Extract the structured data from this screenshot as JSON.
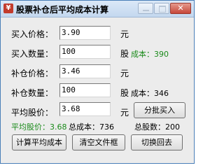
{
  "window": {
    "title": "股票补仓后平均成本计算"
  },
  "form": {
    "buy_price_label": "买入价格：",
    "buy_price_value": "3.90",
    "buy_price_unit": "元",
    "buy_qty_label": "买入数量：",
    "buy_qty_value": "100",
    "buy_qty_unit": "股",
    "buy_cost_text": "成本：390",
    "add_price_label": "补仓价格：",
    "add_price_value": "3.46",
    "add_price_unit": "元",
    "add_qty_label": "补仓数量：",
    "add_qty_value": "100",
    "add_qty_unit": "股",
    "add_cost_text": "成本：346",
    "avg_price_label": "平均股价：",
    "avg_price_value": "3.68",
    "avg_price_unit": "元"
  },
  "summary": {
    "avg_price_text": "平均股价：3.68",
    "total_cost_text": "总成本：736",
    "total_shares_text": "总股数：200"
  },
  "buttons": {
    "split_buy": "分批买入",
    "calc_avg_cost": "计算平均成本",
    "clear_fields": "清空文件框",
    "switch_back": "切换回去"
  },
  "colors": {
    "highlight_green": "#1a8a1a",
    "title_gradient_top": "#dbe8f7",
    "close_red": "#c6473a"
  }
}
